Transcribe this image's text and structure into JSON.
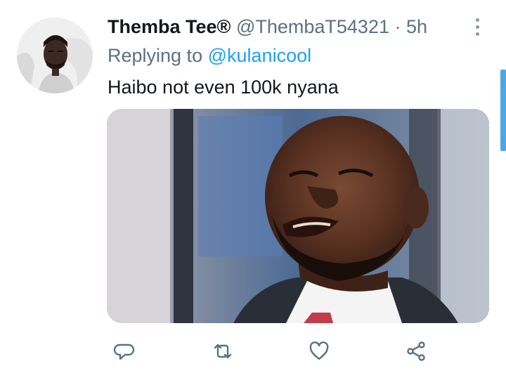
{
  "tweet": {
    "display_name": "Themba Tee®",
    "handle": "@ThembaT54321",
    "separator": "·",
    "timestamp": "5h",
    "replying_prefix": "Replying to",
    "replying_to": "@kulanicool",
    "text": "Haibo not even 100k nyana"
  },
  "actions": {
    "reply": "reply-icon",
    "retweet": "retweet-icon",
    "like": "heart-icon",
    "share": "share-icon"
  },
  "colors": {
    "primary_text": "#14171a",
    "secondary_text": "#5b7083",
    "link": "#1da1f2",
    "icon": "#5b7083"
  }
}
